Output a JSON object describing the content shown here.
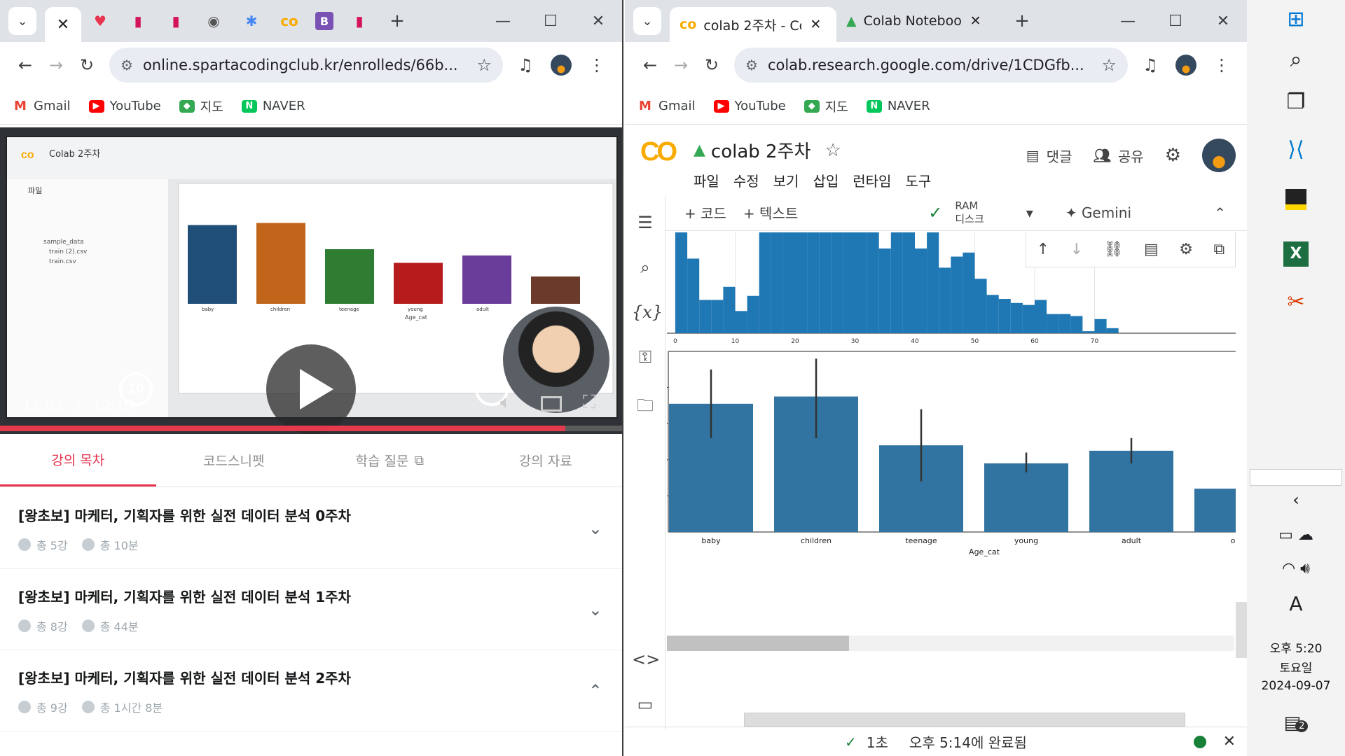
{
  "left_window": {
    "tab_title": "colab 2주차 - Col",
    "url": "online.spartacodingclub.kr/enrolleds/66b...",
    "bookmarks": [
      "Gmail",
      "YouTube",
      "지도",
      "NAVER"
    ],
    "video": {
      "inner_title": "Colab 2주차",
      "current_time": "11:02",
      "separator": "/",
      "duration": "12:10",
      "progress_fraction": 0.907,
      "skip_back": "10",
      "skip_fwd": "10",
      "inner_categories": [
        "baby",
        "children",
        "teenage",
        "young",
        "adult",
        "old"
      ],
      "inner_xlabel": "Age_cat",
      "inner_sidebar": [
        "파일",
        "sample_data",
        "train (2).csv",
        "train.csv"
      ]
    },
    "tabs": [
      "강의 목차",
      "코드스니펫",
      "학습 질문",
      "강의 자료"
    ],
    "courses": [
      {
        "title": "[왕초보] 마케터, 기획자를 위한 실전 데이터 분석 0주차",
        "lessons": "총 5강",
        "duration": "총 10분",
        "chevron": "⌄"
      },
      {
        "title": "[왕초보] 마케터, 기획자를 위한 실전 데이터 분석 1주차",
        "lessons": "총 8강",
        "duration": "총 44분",
        "chevron": "⌄"
      },
      {
        "title": "[왕초보] 마케터, 기획자를 위한 실전 데이터 분석 2주차",
        "lessons": "총 9강",
        "duration": "총 1시간 8분",
        "chevron": "⌃"
      }
    ]
  },
  "right_window": {
    "tabs": [
      "colab 2주차 - Col",
      "Colab Notebooks"
    ],
    "url": "colab.research.google.com/drive/1CDGfb...",
    "bookmarks": [
      "Gmail",
      "YouTube",
      "지도",
      "NAVER"
    ],
    "notebook_title": "colab 2주차",
    "menu": [
      "파일",
      "수정",
      "보기",
      "삽입",
      "런타임",
      "도구"
    ],
    "actions": {
      "comment": "댓글",
      "share": "공유"
    },
    "toolbar": {
      "code": "+ 코드",
      "text": "+ 텍스트",
      "ram": "RAM",
      "disk": "디스크",
      "gemini": "Gemini"
    },
    "status": {
      "check": "✓",
      "duration": "1초",
      "completed": "오후 5:14에 완료됨"
    }
  },
  "chart_data": [
    {
      "type": "bar",
      "title": "",
      "xlabel": "",
      "ylabel": "",
      "x_ticks": [
        0,
        10,
        20,
        30,
        40,
        50,
        60,
        70
      ],
      "note": "histogram of Age (partially visible, clipped at top)",
      "bins": [
        {
          "x": 1,
          "v": 1.0
        },
        {
          "x": 3,
          "v": 0.74
        },
        {
          "x": 5,
          "v": 0.33
        },
        {
          "x": 7,
          "v": 0.33
        },
        {
          "x": 9,
          "v": 0.46
        },
        {
          "x": 11,
          "v": 0.22
        },
        {
          "x": 13,
          "v": 0.37
        },
        {
          "x": 15,
          "v": 1.0
        },
        {
          "x": 17,
          "v": 1.0
        },
        {
          "x": 19,
          "v": 1.0
        },
        {
          "x": 21,
          "v": 1.0
        },
        {
          "x": 23,
          "v": 1.0
        },
        {
          "x": 25,
          "v": 1.0
        },
        {
          "x": 27,
          "v": 1.0
        },
        {
          "x": 29,
          "v": 1.0
        },
        {
          "x": 31,
          "v": 1.0
        },
        {
          "x": 33,
          "v": 1.0
        },
        {
          "x": 35,
          "v": 0.84
        },
        {
          "x": 37,
          "v": 1.0
        },
        {
          "x": 39,
          "v": 1.0
        },
        {
          "x": 41,
          "v": 0.84
        },
        {
          "x": 43,
          "v": 1.0
        },
        {
          "x": 45,
          "v": 0.65
        },
        {
          "x": 47,
          "v": 0.76
        },
        {
          "x": 49,
          "v": 0.8
        },
        {
          "x": 51,
          "v": 0.54
        },
        {
          "x": 53,
          "v": 0.38
        },
        {
          "x": 55,
          "v": 0.34
        },
        {
          "x": 57,
          "v": 0.3
        },
        {
          "x": 59,
          "v": 0.28
        },
        {
          "x": 61,
          "v": 0.33
        },
        {
          "x": 63,
          "v": 0.19
        },
        {
          "x": 65,
          "v": 0.19
        },
        {
          "x": 67,
          "v": 0.17
        },
        {
          "x": 69,
          "v": 0.02
        },
        {
          "x": 71,
          "v": 0.14
        },
        {
          "x": 73,
          "v": 0.05
        }
      ]
    },
    {
      "type": "bar",
      "title": "",
      "xlabel": "Age_cat",
      "ylabel": "",
      "categories": [
        "baby",
        "children",
        "teenage",
        "young",
        "adult",
        "old"
      ],
      "values": [
        0.71,
        0.75,
        0.48,
        0.38,
        0.45,
        0.24
      ],
      "err_low": [
        0.52,
        0.52,
        0.28,
        0.33,
        0.38,
        0.24
      ],
      "err_high": [
        0.9,
        0.96,
        0.68,
        0.44,
        0.52,
        0.24
      ],
      "ylim": [
        0,
        1.0
      ]
    }
  ],
  "taskbar": {
    "time": "오후 5:20",
    "day": "토요일",
    "date": "2024-09-07",
    "notification_count": "2",
    "ime": "A"
  }
}
